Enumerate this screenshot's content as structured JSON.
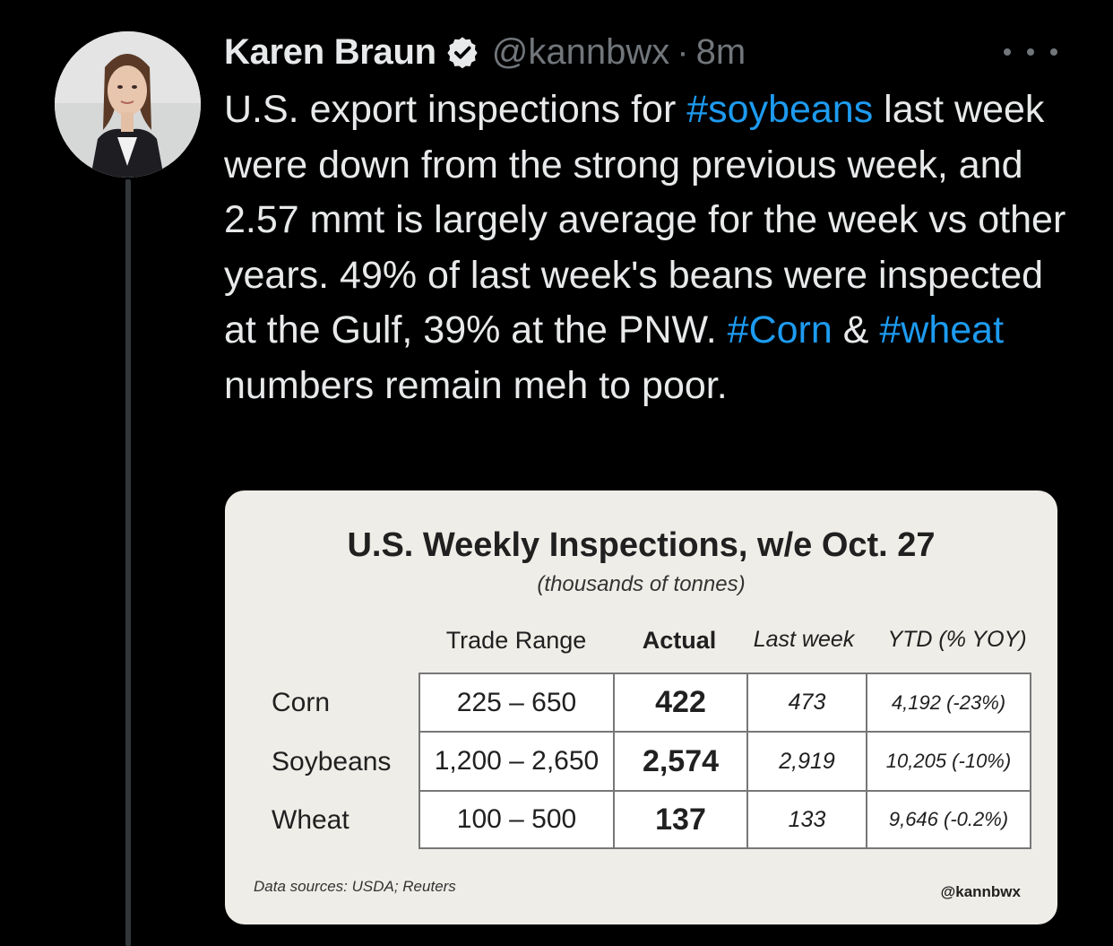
{
  "tweet": {
    "author_name": "Karen Braun",
    "handle": "@kannbwx",
    "separator": "·",
    "time": "8m",
    "text_segments": [
      {
        "text": "U.S. export inspections for ",
        "type": "text"
      },
      {
        "text": "#soybeans",
        "type": "hashtag"
      },
      {
        "text": " last week were down from the strong previous week, and 2.57 mmt is largely average for the week vs other years. 49% of last week's beans were inspected at the Gulf, 39% at the PNW. ",
        "type": "text"
      },
      {
        "text": "#Corn",
        "type": "hashtag"
      },
      {
        "text": " & ",
        "type": "text"
      },
      {
        "text": "#wheat",
        "type": "hashtag"
      },
      {
        "text": " numbers remain meh to poor.",
        "type": "text"
      }
    ],
    "icons": {
      "verified": "verified-badge-icon",
      "more": "more-options-icon"
    },
    "colors": {
      "background": "#000000",
      "text": "#e7e9ea",
      "muted": "#71767b",
      "hashtag": "#1d9bf0"
    }
  },
  "card": {
    "title": "U.S. Weekly Inspections, w/e Oct. 27",
    "subtitle": "(thousands of tonnes)",
    "columns": [
      "Trade Range",
      "Actual",
      "Last week",
      "YTD (% YOY)"
    ],
    "rows": [
      {
        "label": "Corn",
        "trade_range": "225 – 650",
        "actual": "422",
        "last_week": "473",
        "ytd": "4,192 (-23%)"
      },
      {
        "label": "Soybeans",
        "trade_range": "1,200 – 2,650",
        "actual": "2,574",
        "last_week": "2,919",
        "ytd": "10,205 (-10%)"
      },
      {
        "label": "Wheat",
        "trade_range": "100 – 500",
        "actual": "137",
        "last_week": "133",
        "ytd": "9,646 (-0.2%)"
      }
    ],
    "footer_source": "Data sources: USDA; Reuters",
    "footer_handle": "@kannbwx"
  }
}
